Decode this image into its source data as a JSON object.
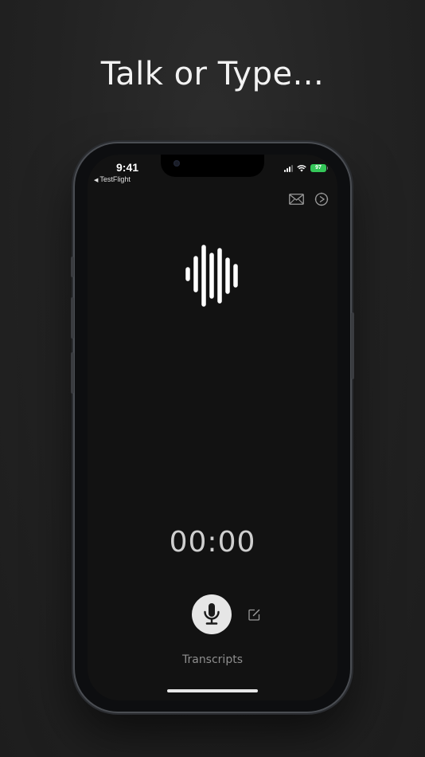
{
  "headline": "Talk or Type...",
  "status_bar": {
    "time": "9:41",
    "back_link": "TestFlight",
    "back_icon": "back-triangle-icon",
    "battery": "97",
    "battery_color": "#34c759",
    "signal_icon": "cellular-signal-icon",
    "wifi_icon": "wifi-icon"
  },
  "toolbar": {
    "mail_icon": "mail-icon",
    "settings_icon": "settings-gear-icon"
  },
  "waveform_icon": "waveform-icon",
  "timer": "00:00",
  "controls": {
    "mic_icon": "microphone-icon",
    "compose_icon": "compose-icon",
    "mic_button_color": "#e6e6e6"
  },
  "transcripts_label": "Transcripts"
}
